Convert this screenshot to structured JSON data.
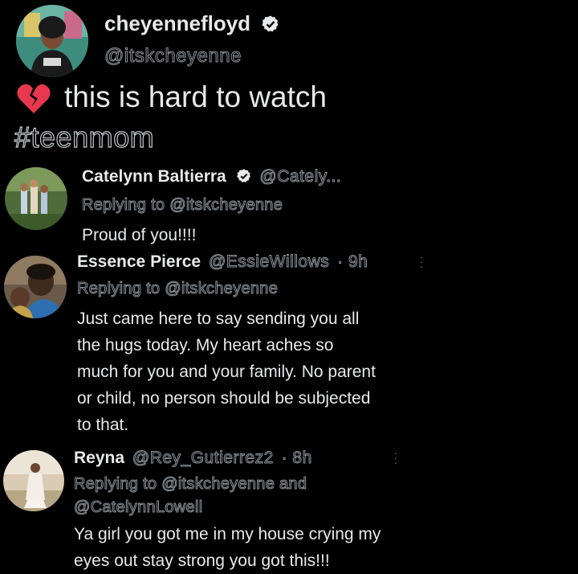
{
  "main_tweet": {
    "display_name": "cheyennefloyd",
    "handle": "@itskcheyenne",
    "emoji_icon": "broken-heart-icon",
    "text": "this is hard to watch",
    "hashtag": "#teenmom"
  },
  "replies": [
    {
      "display_name": "Catelynn Baltierra",
      "handle": "@Cately...",
      "verified": true,
      "time": "",
      "replying_to": "Replying to @itskcheyenne",
      "replying_to_cont": "",
      "text": "Proud of you!!!!"
    },
    {
      "display_name": "Essence Pierce",
      "handle": "@EssieWillows",
      "verified": false,
      "time": "· 9h",
      "replying_to": "Replying to @itskcheyenne",
      "replying_to_cont": "",
      "text_lines": [
        "Just came here to say sending you all",
        "the hugs today. My heart aches so",
        "much for you and your family. No parent",
        "or child, no person should be subjected",
        "to that."
      ]
    },
    {
      "display_name": "Reyna",
      "handle": "@Rey_Gutierrez2",
      "verified": false,
      "time": "· 8h",
      "replying_to": "Replying to @itskcheyenne and",
      "replying_to_cont": "@CatelynnLowell",
      "text_lines": [
        "Ya girl you got me in my house crying my",
        "eyes out stay strong you got this!!!"
      ]
    }
  ],
  "colors": {
    "background": "#000000",
    "text": "#e7e9ea",
    "muted": "#71767b",
    "verified_badge": "#e7e9ea",
    "heart": "#e8384f"
  }
}
